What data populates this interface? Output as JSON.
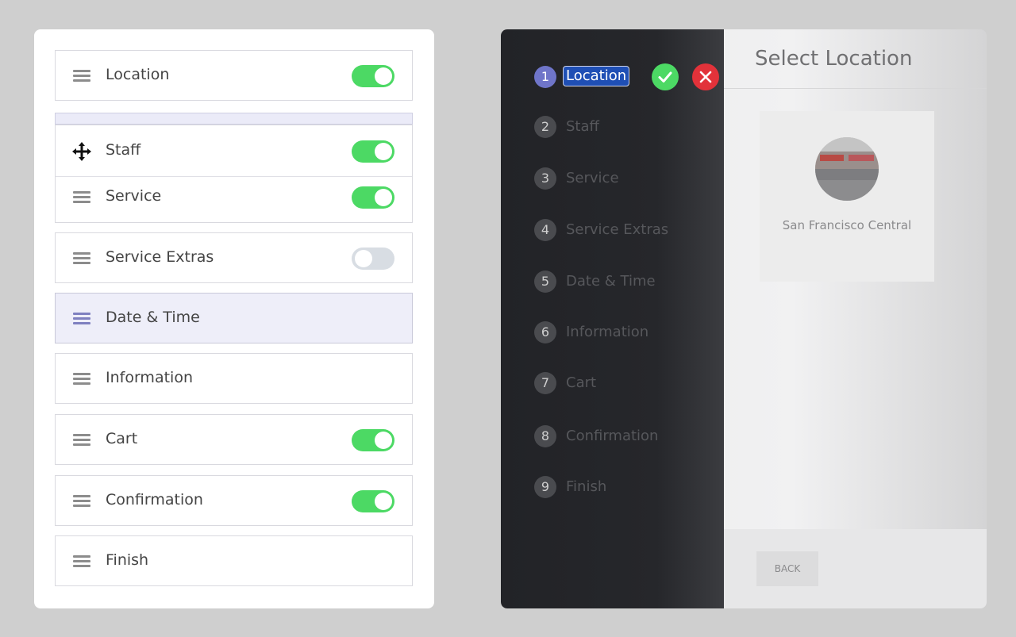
{
  "left_list": {
    "items": [
      {
        "label": "Location",
        "toggle": "on"
      },
      {
        "label": "Staff",
        "toggle": "on",
        "state": "dragging"
      },
      {
        "label": "Service",
        "toggle": "on"
      },
      {
        "label": "Service Extras",
        "toggle": "off"
      },
      {
        "label": "Date & Time",
        "state": "highlighted"
      },
      {
        "label": "Information"
      },
      {
        "label": "Cart",
        "toggle": "on"
      },
      {
        "label": "Confirmation",
        "toggle": "on"
      },
      {
        "label": "Finish"
      }
    ]
  },
  "steps_panel": {
    "steps": [
      {
        "number": "1",
        "label": "Location"
      },
      {
        "number": "2",
        "label": "Staff"
      },
      {
        "number": "3",
        "label": "Service"
      },
      {
        "number": "4",
        "label": "Service Extras"
      },
      {
        "number": "5",
        "label": "Date & Time"
      },
      {
        "number": "6",
        "label": "Information"
      },
      {
        "number": "7",
        "label": "Cart"
      },
      {
        "number": "8",
        "label": "Confirmation"
      },
      {
        "number": "9",
        "label": "Finish"
      }
    ],
    "confirm_icon": "check-icon",
    "cancel_icon": "close-icon"
  },
  "content": {
    "title": "Select Location",
    "location_card": {
      "name": "San Francisco Central"
    },
    "back_label": "BACK"
  },
  "colors": {
    "toggle_on": "#4cd964",
    "toggle_off": "#d8dde3",
    "accent": "#6f75c9",
    "cancel": "#e2323a",
    "sidebar_dark": "#25262a"
  }
}
